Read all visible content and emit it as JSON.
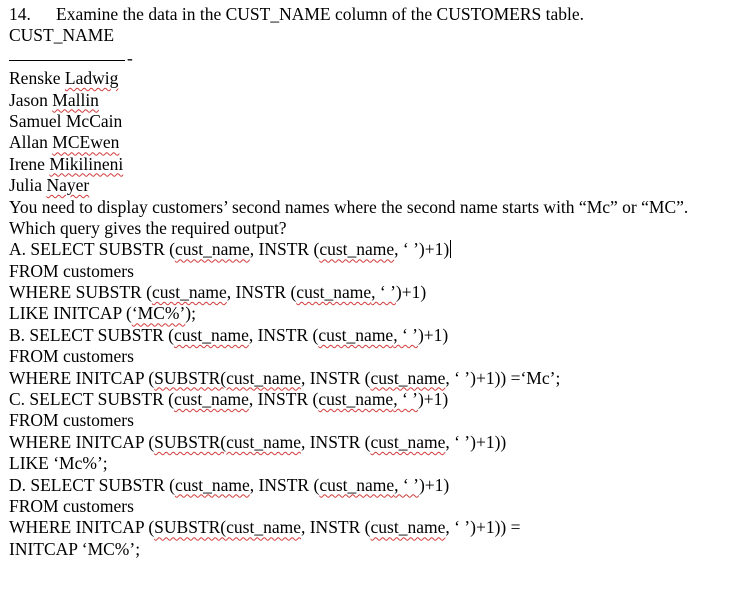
{
  "question": {
    "number": "14.",
    "text": "Examine the data in the CUST_NAME column of the CUSTOMERS table."
  },
  "column_header": "CUST_NAME",
  "separator_dash": "-",
  "names": [
    {
      "first": "Renske ",
      "last": "Ladwig"
    },
    {
      "first": "Jason ",
      "last": "Mallin"
    },
    {
      "first": "Samuel ",
      "last": "McCain"
    },
    {
      "first": "Allan ",
      "last": "MCEwen"
    },
    {
      "first": "Irene ",
      "last": "Mikilineni"
    },
    {
      "first": "Julia ",
      "last": "Nayer"
    }
  ],
  "instruction": "You need to display customers’ second names where the second name starts with “Mc” or “MC”.",
  "prompt": "Which query gives the required output?",
  "options": {
    "a": {
      "l1_pre": "A. SELECT SUBSTR (",
      "l1_c1": "cust_name",
      "l1_mid": ", INSTR (",
      "l1_c2": "cust_name",
      "l1_post": ", ‘ ’)+1)",
      "l2": "FROM customers",
      "l3_pre": "WHERE SUBSTR (",
      "l3_c1": "cust_name",
      "l3_mid": ", INSTR (",
      "l3_c2": "cust_name",
      "l3_q": ", ‘ ’",
      "l3_post": ")+1)",
      "l4_pre": "LIKE INITCAP (",
      "l4_sq": "‘MC%’",
      "l4_post": ");"
    },
    "b": {
      "l1_pre": "B. SELECT SUBSTR (",
      "l1_c1": "cust_name",
      "l1_mid": ", INSTR (",
      "l1_c2": "cust_name",
      "l1_q": ", ‘ ’",
      "l1_post": ")+1)",
      "l2": "FROM customers",
      "l3_pre": "WHERE INITCAP (",
      "l3_sq": "SUBSTR(cust_name",
      "l3_mid": ", INSTR (",
      "l3_c2": "cust_name",
      "l3_post": ", ‘ ’)+1)) =‘Mc’;"
    },
    "c": {
      "l1_pre": "C. SELECT SUBSTR (",
      "l1_c1": "cust_name",
      "l1_mid": ", INSTR (",
      "l1_c2": "cust_name",
      "l1_q": ", ‘ ’",
      "l1_post": ")+1)",
      "l2": "FROM customers",
      "l3_pre": "WHERE INITCAP (",
      "l3_sq": "SUBSTR(cust_name",
      "l3_mid": ", INSTR (",
      "l3_c2": "cust_name",
      "l3_post": ", ‘ ’)+1))",
      "l4": "LIKE ‘Mc%’;"
    },
    "d": {
      "l1_pre": "D. SELECT SUBSTR (",
      "l1_c1": "cust_name",
      "l1_mid": ", INSTR (",
      "l1_c2": "cust_name",
      "l1_q": ", ‘ ’",
      "l1_post": ")+1)",
      "l2": "FROM customers",
      "l3_pre": "WHERE INITCAP (",
      "l3_sq": "SUBSTR(cust_name",
      "l3_mid": ", INSTR (",
      "l3_c2": "cust_name",
      "l3_post": ", ‘ ’)+1)) =",
      "l4": "INITCAP ‘MC%’;"
    }
  }
}
